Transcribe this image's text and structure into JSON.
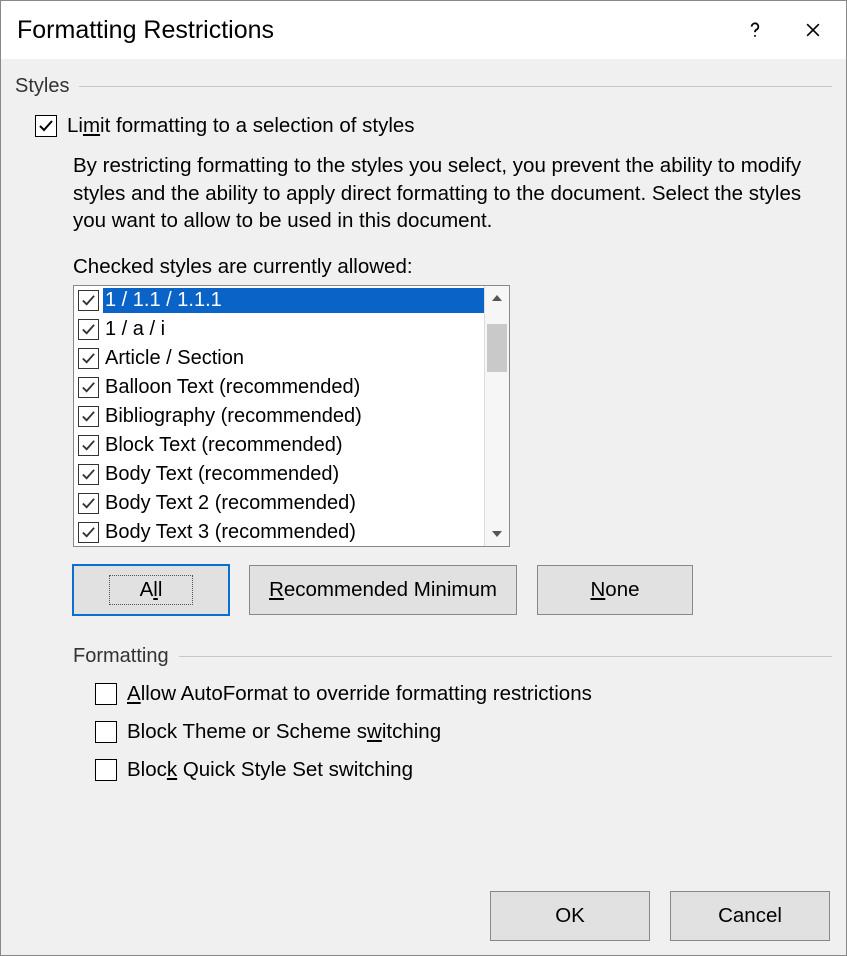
{
  "dialog": {
    "title": "Formatting Restrictions"
  },
  "styles_section": {
    "label": "Styles",
    "limit_checkbox": "Limit formatting to a selection of styles",
    "description": "By restricting formatting to the styles you select, you prevent the ability to modify styles and the ability to apply direct formatting to the document. Select the styles you want to allow to be used in this document.",
    "list_label": "Checked styles are currently allowed:",
    "items": [
      {
        "label": "1 / 1.1 / 1.1.1",
        "checked": true,
        "selected": true
      },
      {
        "label": "1 / a / i",
        "checked": true,
        "selected": false
      },
      {
        "label": "Article / Section",
        "checked": true,
        "selected": false
      },
      {
        "label": "Balloon Text (recommended)",
        "checked": true,
        "selected": false
      },
      {
        "label": "Bibliography (recommended)",
        "checked": true,
        "selected": false
      },
      {
        "label": "Block Text (recommended)",
        "checked": true,
        "selected": false
      },
      {
        "label": "Body Text (recommended)",
        "checked": true,
        "selected": false
      },
      {
        "label": "Body Text 2 (recommended)",
        "checked": true,
        "selected": false
      },
      {
        "label": "Body Text 3 (recommended)",
        "checked": true,
        "selected": false
      }
    ],
    "buttons": {
      "all": "All",
      "recommended": "Recommended Minimum",
      "none": "None"
    }
  },
  "formatting_section": {
    "label": "Formatting",
    "allow_autoformat": "Allow AutoFormat to override formatting restrictions",
    "block_theme": "Block Theme or Scheme switching",
    "block_quickstyle": "Block Quick Style Set switching"
  },
  "footer": {
    "ok": "OK",
    "cancel": "Cancel"
  }
}
